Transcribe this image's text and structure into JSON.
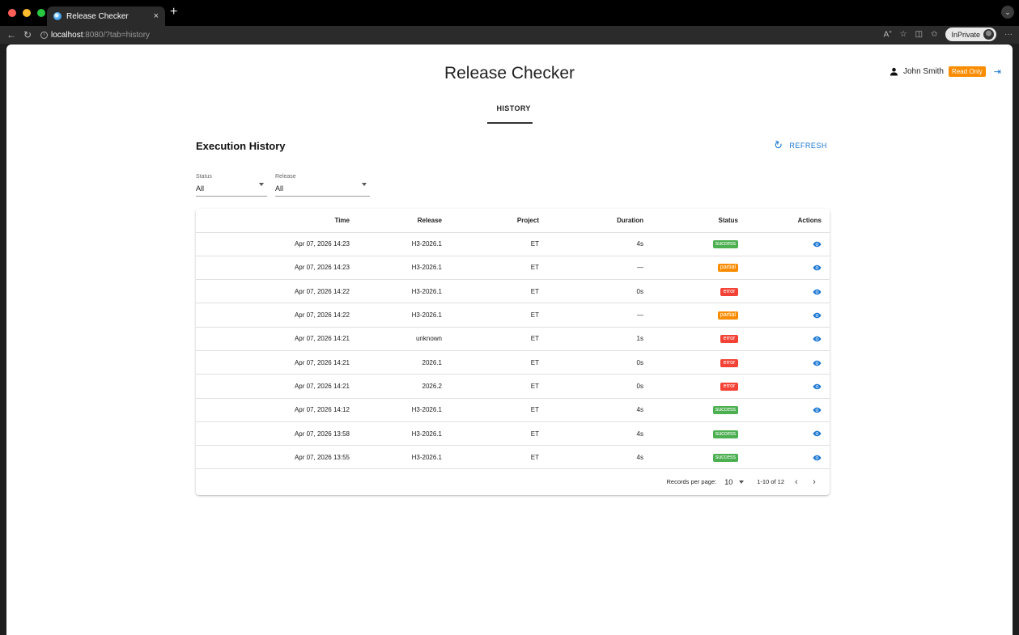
{
  "browser": {
    "tab_title": "Release Checker",
    "tab_close": "×",
    "new_tab": "+",
    "url_host": "localhost",
    "url_rest": ":8080/?tab=history",
    "inprivate_label": "InPrivate",
    "icons": [
      "back-icon",
      "reload-icon",
      "info-icon",
      "read-aloud-icon",
      "favorite-icon",
      "split-screen-icon",
      "favorites-icon",
      "more-icon"
    ]
  },
  "app": {
    "title": "Release Checker",
    "user_name": "John Smith",
    "role_badge": "Read Only",
    "nav_tab": "HISTORY"
  },
  "history": {
    "title": "Execution History",
    "refresh_label": "REFRESH",
    "filters": {
      "status_label": "Status",
      "status_value": "All",
      "release_label": "Release",
      "release_value": "All"
    },
    "columns": {
      "time": "Time",
      "release": "Release",
      "project": "Project",
      "duration": "Duration",
      "status": "Status",
      "actions": "Actions"
    },
    "rows": [
      {
        "time": "Apr 07, 2026 14:23",
        "release": "H3-2026.1",
        "project": "ET",
        "duration": "4s",
        "status": "success"
      },
      {
        "time": "Apr 07, 2026 14:23",
        "release": "H3-2026.1",
        "project": "ET",
        "duration": "—",
        "status": "partial"
      },
      {
        "time": "Apr 07, 2026 14:22",
        "release": "H3-2026.1",
        "project": "ET",
        "duration": "0s",
        "status": "error"
      },
      {
        "time": "Apr 07, 2026 14:22",
        "release": "H3-2026.1",
        "project": "ET",
        "duration": "—",
        "status": "partial"
      },
      {
        "time": "Apr 07, 2026 14:21",
        "release": "unknown",
        "project": "ET",
        "duration": "1s",
        "status": "error"
      },
      {
        "time": "Apr 07, 2026 14:21",
        "release": "2026.1",
        "project": "ET",
        "duration": "0s",
        "status": "error"
      },
      {
        "time": "Apr 07, 2026 14:21",
        "release": "2026.2",
        "project": "ET",
        "duration": "0s",
        "status": "error"
      },
      {
        "time": "Apr 07, 2026 14:12",
        "release": "H3-2026.1",
        "project": "ET",
        "duration": "4s",
        "status": "success"
      },
      {
        "time": "Apr 07, 2026 13:58",
        "release": "H3-2026.1",
        "project": "ET",
        "duration": "4s",
        "status": "success"
      },
      {
        "time": "Apr 07, 2026 13:55",
        "release": "H3-2026.1",
        "project": "ET",
        "duration": "4s",
        "status": "success"
      }
    ],
    "pagination": {
      "records_per_page_label": "Records per page:",
      "records_per_page": "10",
      "range": "1-10 of 12"
    }
  },
  "colors": {
    "accent": "#1976d2",
    "success": "#4caf50",
    "partial": "#fb8c00",
    "error": "#f44336",
    "read_only_badge": "#fb8c00"
  }
}
